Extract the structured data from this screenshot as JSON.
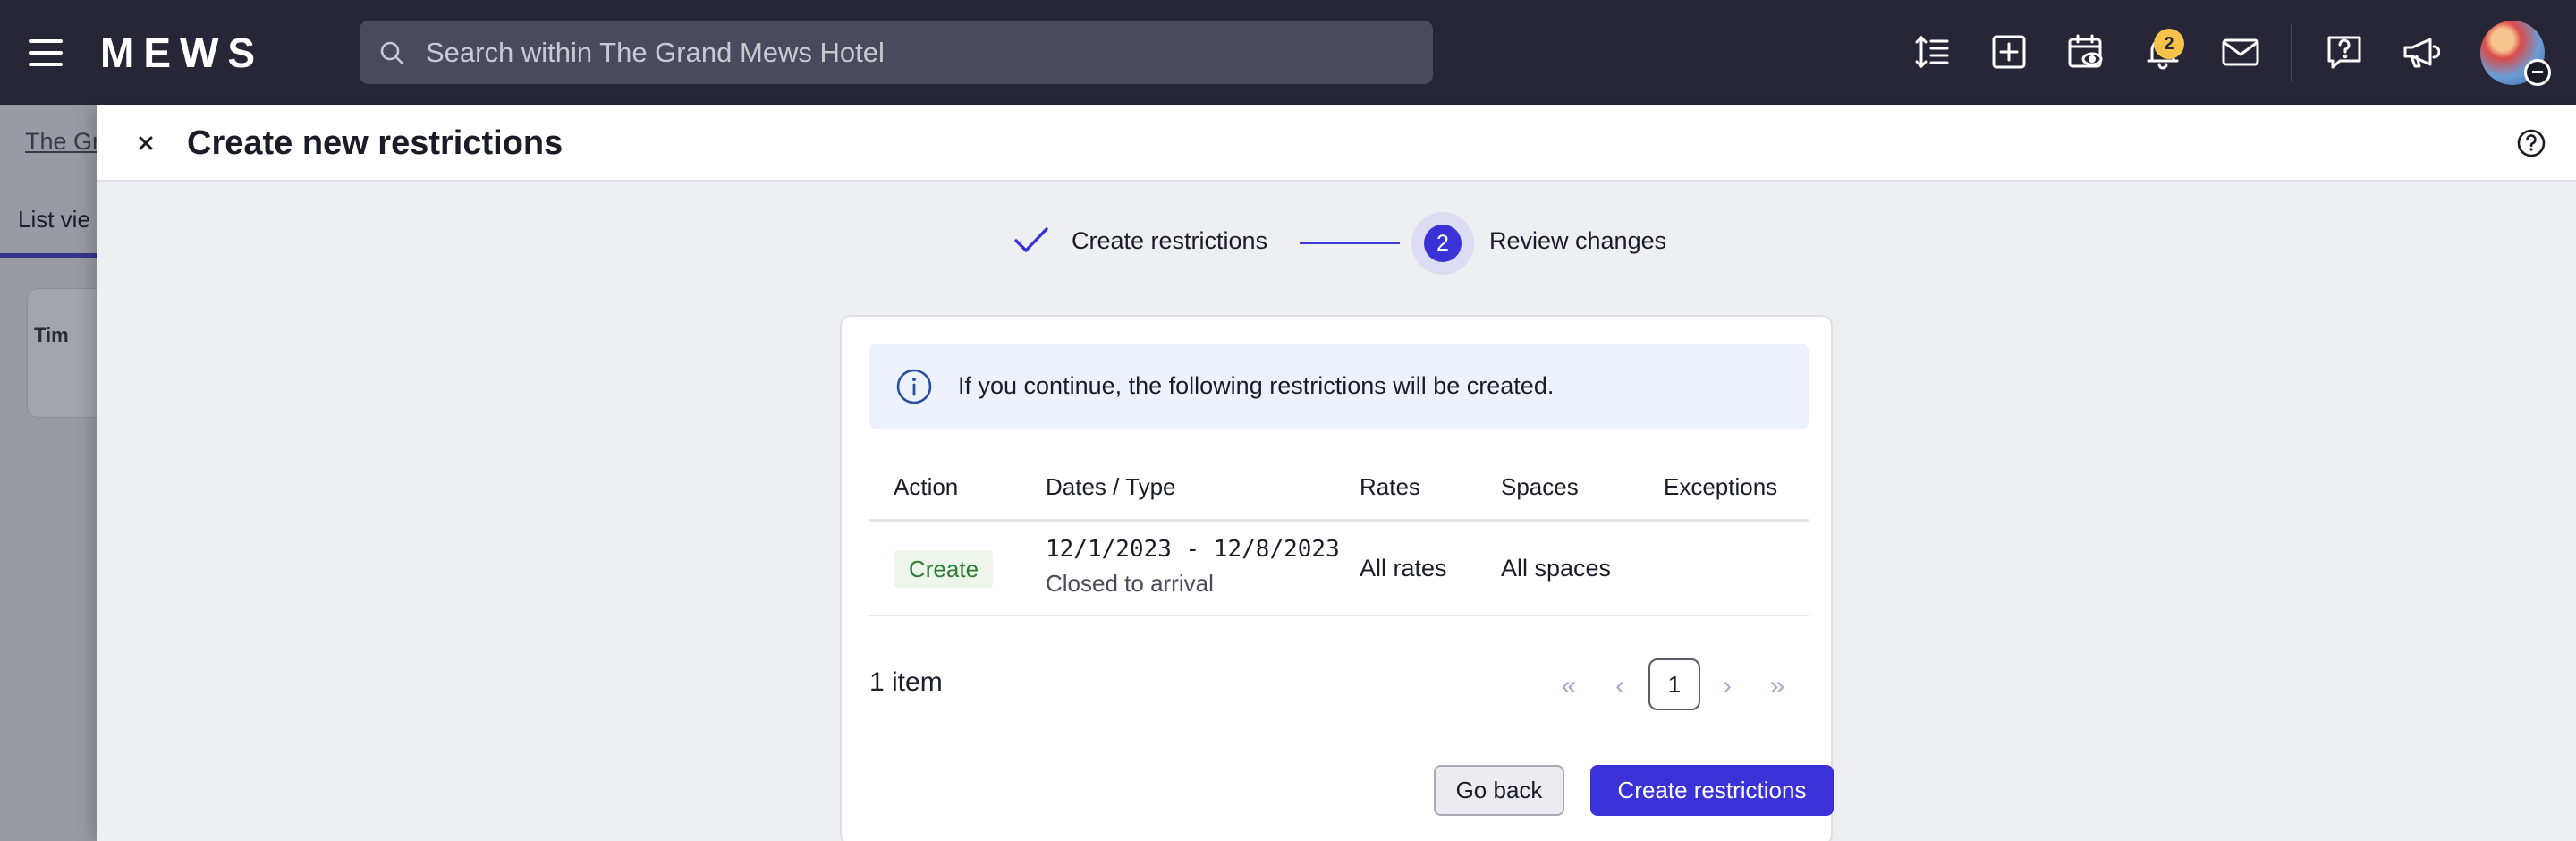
{
  "topbar": {
    "logo": "MEWS",
    "search_placeholder": "Search within The Grand Mews Hotel",
    "notification_count": "2",
    "icons": [
      "menu-icon",
      "line-height-icon",
      "add-square-icon",
      "calendar-view-icon",
      "bell-icon",
      "mail-icon",
      "help-chat-icon",
      "megaphone-icon",
      "avatar"
    ]
  },
  "background": {
    "breadcrumb": "The Gr",
    "tab": "List vie",
    "card_label": "Tim"
  },
  "panel": {
    "title": "Create new restrictions",
    "stepper": {
      "step1_label": "Create restrictions",
      "step2_number": "2",
      "step2_label": "Review changes"
    },
    "info_text": "If you continue, the following restrictions will be created.",
    "table": {
      "headers": [
        "Action",
        "Dates / Type",
        "Rates",
        "Spaces",
        "Exceptions"
      ],
      "rows": [
        {
          "action": "Create",
          "dates": "12/1/2023 - 12/8/2023",
          "type": "Closed to arrival",
          "rates": "All rates",
          "spaces": "All spaces",
          "exceptions": ""
        }
      ]
    },
    "pagination": {
      "count_label": "1 item",
      "current_page": "1",
      "first": "«",
      "prev": "‹",
      "next": "›",
      "last": "»"
    },
    "buttons": {
      "back": "Go back",
      "create": "Create restrictions"
    }
  },
  "colors": {
    "topbar": "#262637",
    "primary": "#3a32d6",
    "badge": "#f5c24a",
    "create_tag_bg": "#eef6ec",
    "create_tag_text": "#2f7d35"
  }
}
